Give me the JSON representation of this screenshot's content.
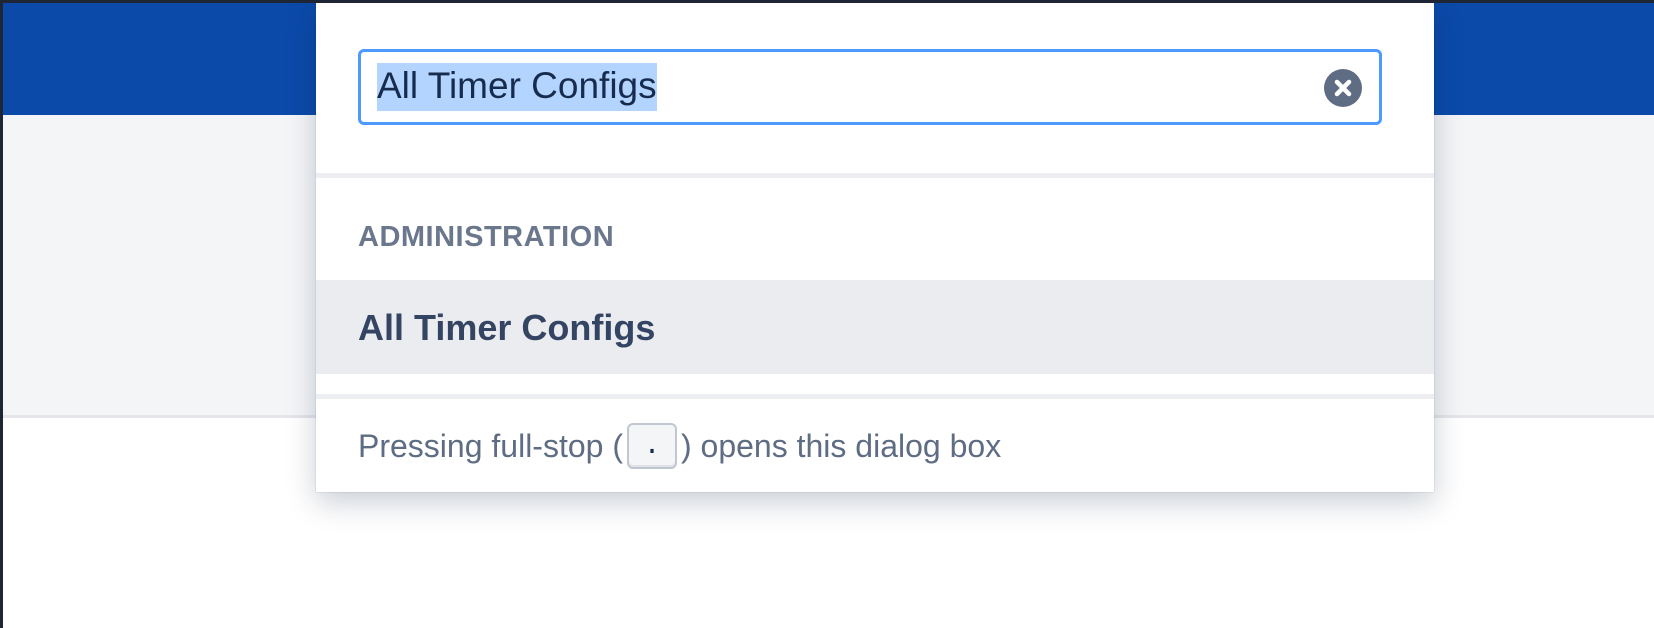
{
  "search": {
    "value": "All Timer Configs"
  },
  "results": {
    "section_heading": "ADMINISTRATION",
    "items": [
      {
        "label": "All Timer Configs"
      }
    ]
  },
  "footer": {
    "hint_prefix": "Pressing full-stop (",
    "key": ".",
    "hint_suffix": ") opens this dialog box"
  },
  "icons": {
    "clear": "close-circle-icon"
  },
  "colors": {
    "header": "#0b4aa9",
    "focus_ring": "#4c9aff",
    "selection": "#b3d4ff",
    "item_highlight": "#ebecf0",
    "heading_text": "#6b778c"
  }
}
